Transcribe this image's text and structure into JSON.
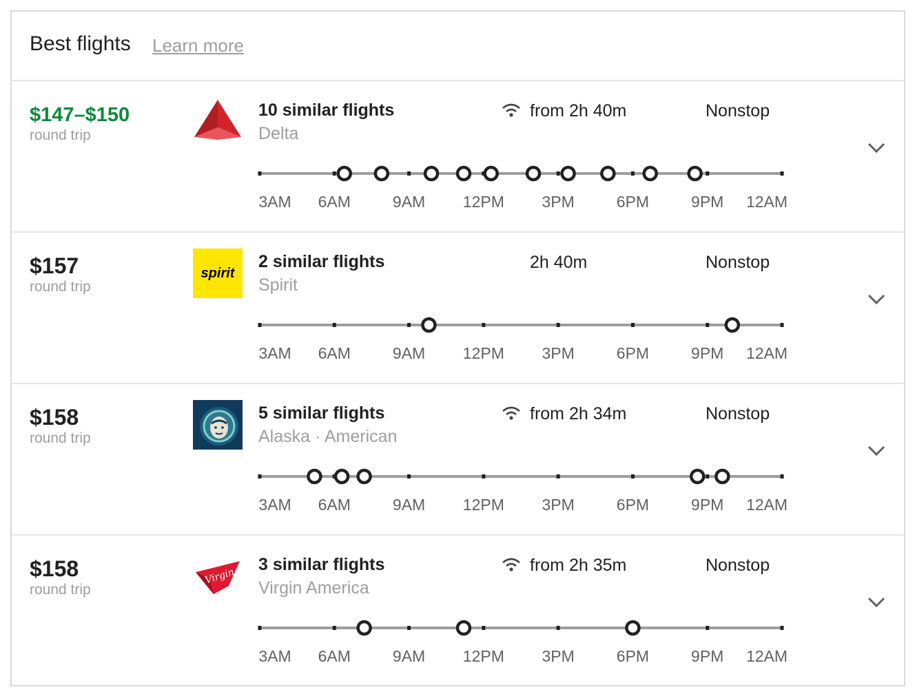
{
  "header": {
    "title": "Best flights",
    "learn_more": "Learn more"
  },
  "timeline_labels": [
    "3AM",
    "6AM",
    "9AM",
    "12PM",
    "3PM",
    "6PM",
    "9PM",
    "12AM"
  ],
  "colors": {
    "price_highlight": "#0b8a3a",
    "delta_red": "#d2232a",
    "spirit_yellow": "#ffe600",
    "alaska_blue": "#0e3a5c",
    "virgin_red": "#e01933"
  },
  "rows": [
    {
      "price": "$147–$150",
      "price_highlight": true,
      "price_sub": "round trip",
      "logo": "delta-logo",
      "count": "10 similar flights",
      "airline": "Delta",
      "wifi": true,
      "duration": "from 2h 40m",
      "stops": "Nonstop",
      "departures_hours": [
        6.4,
        7.9,
        9.9,
        11.2,
        12.3,
        14.0,
        15.4,
        17.0,
        18.7,
        20.5
      ]
    },
    {
      "price": "$157",
      "price_highlight": false,
      "price_sub": "round trip",
      "logo": "spirit-logo",
      "count": "2 similar flights",
      "airline": "Spirit",
      "wifi": false,
      "duration": "2h 40m",
      "stops": "Nonstop",
      "departures_hours": [
        9.8,
        22.0
      ]
    },
    {
      "price": "$158",
      "price_highlight": false,
      "price_sub": "round trip",
      "logo": "alaska-logo",
      "count": "5 similar flights",
      "airline": "Alaska · American",
      "wifi": true,
      "duration": "from 2h 34m",
      "stops": "Nonstop",
      "departures_hours": [
        5.2,
        6.3,
        7.2,
        20.6,
        21.6
      ]
    },
    {
      "price": "$158",
      "price_highlight": false,
      "price_sub": "round trip",
      "logo": "virgin-logo",
      "count": "3 similar flights",
      "airline": "Virgin America",
      "wifi": true,
      "duration": "from 2h 35m",
      "stops": "Nonstop",
      "departures_hours": [
        7.2,
        11.2,
        18.0
      ]
    }
  ]
}
